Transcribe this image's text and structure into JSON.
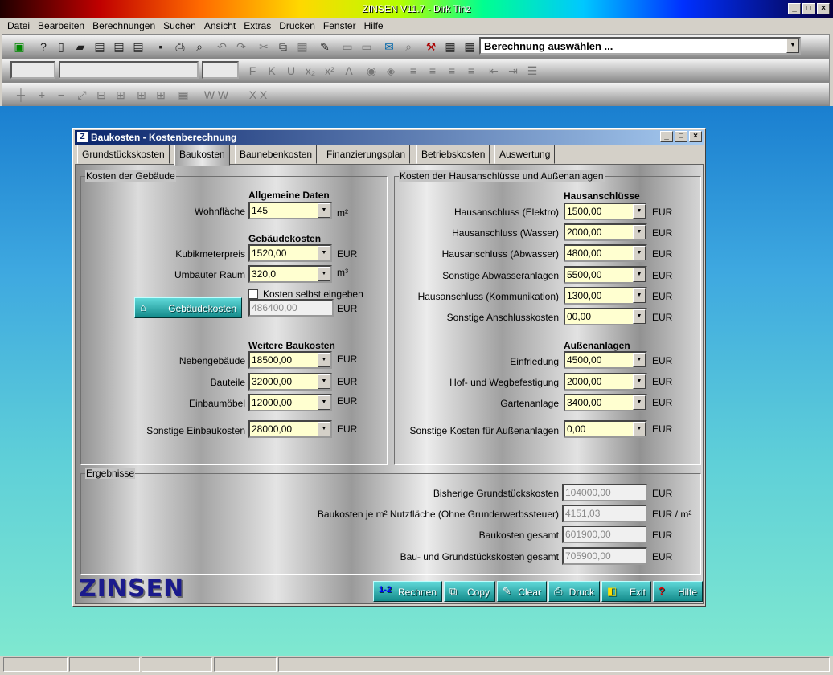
{
  "window": {
    "title": "ZINSEN V11.7 - Dirk Tinz"
  },
  "menu": [
    "Datei",
    "Bearbeiten",
    "Berechnungen",
    "Suchen",
    "Ansicht",
    "Extras",
    "Drucken",
    "Fenster",
    "Hilfe"
  ],
  "toolbar": {
    "calc_select": "Berechnung auswählen ..."
  },
  "dialog": {
    "title": "Baukosten - Kostenberechnung",
    "tabs": [
      "Grundstückskosten",
      "Baukosten",
      "Baunebenkosten",
      "Finanzierungsplan",
      "Betriebskosten",
      "Auswertung"
    ],
    "active_tab": "Baukosten",
    "left": {
      "caption": "Kosten der Gebäude",
      "h_allg": "Allgemeine Daten",
      "wohnflaeche_label": "Wohnfläche",
      "wohnflaeche": "145",
      "unit_m2": "m²",
      "h_geb": "Gebäudekosten",
      "kubik_label": "Kubikmeterpreis",
      "kubik": "1520,00",
      "umbauter_label": "Umbauter Raum",
      "umbauter": "320,0",
      "unit_m3": "m³",
      "checkbox_label": "Kosten selbst eingeben",
      "gebaeude_button": "Gebäudekosten",
      "gebaeude_value": "486400,00",
      "h_weitere": "Weitere Baukosten",
      "neben_label": "Nebengebäude",
      "neben": "18500,00",
      "bauteile_label": "Bauteile",
      "bauteile": "32000,00",
      "einbau_label": "Einbaumöbel",
      "einbau": "12000,00",
      "sonst_label": "Sonstige Einbaukosten",
      "sonst": "28000,00",
      "eur": "EUR"
    },
    "right": {
      "caption": "Kosten der Hausanschlüsse und Außenanlagen",
      "h_haus": "Hausanschlüsse",
      "rows": [
        {
          "label": "Hausanschluss (Elektro)",
          "value": "1500,00"
        },
        {
          "label": "Hausanschluss (Wasser)",
          "value": "2000,00"
        },
        {
          "label": "Hausanschluss (Abwasser)",
          "value": "4800,00"
        },
        {
          "label": "Sonstige Abwasseranlagen",
          "value": "5500,00"
        },
        {
          "label": "Hausanschluss (Kommunikation)",
          "value": "1300,00"
        },
        {
          "label": "Sonstige Anschlusskosten",
          "value": "00,00"
        }
      ],
      "h_aussen": "Außenanlagen",
      "rows2": [
        {
          "label": "Einfriedung",
          "value": "4500,00"
        },
        {
          "label": "Hof- und Wegbefestigung",
          "value": "2000,00"
        },
        {
          "label": "Gartenanlage",
          "value": "3400,00"
        },
        {
          "label": "Sonstige Kosten für Außenanlagen",
          "value": "0,00"
        }
      ],
      "eur": "EUR"
    },
    "results": {
      "caption": "Ergebnisse",
      "rows": [
        {
          "label": "Bisherige Grundstückskosten",
          "value": "104000,00",
          "unit": "EUR"
        },
        {
          "label": "Baukosten je m² Nutzfläche (Ohne Grunderwerbssteuer)",
          "value": "4151,03",
          "unit": "EUR / m²"
        },
        {
          "label": "Baukosten gesamt",
          "value": "601900,00",
          "unit": "EUR"
        },
        {
          "label": "Bau- und Grundstückskosten gesamt",
          "value": "705900,00",
          "unit": "EUR"
        }
      ]
    },
    "logo": "ZINSEN",
    "buttons": [
      {
        "icon": "1-2",
        "label": "Rechnen"
      },
      {
        "icon": "⧉",
        "label": "Copy"
      },
      {
        "icon": "✎",
        "label": "Clear"
      },
      {
        "icon": "⎙",
        "label": "Druck"
      },
      {
        "icon": "◧",
        "label": "Exit"
      },
      {
        "icon": "?",
        "label": "Hilfe"
      }
    ]
  }
}
